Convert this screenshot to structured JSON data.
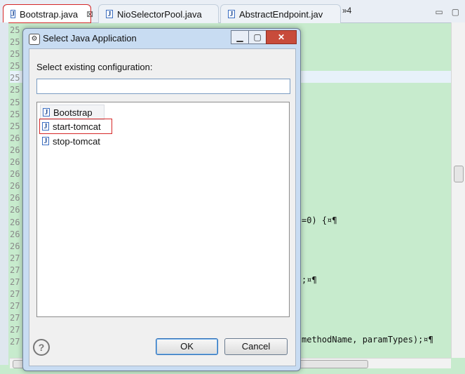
{
  "editor": {
    "tabs": [
      {
        "label": "Bootstrap.java",
        "icon": "java-file-icon"
      },
      {
        "label": "NioSelectorPool.java",
        "icon": "java-file-icon"
      },
      {
        "label": "AbstractEndpoint.jav",
        "icon": "java-file-icon"
      }
    ],
    "tab_overflow": "»4",
    "line_numbers": [
      "25",
      "25",
      "25",
      "25",
      "25",
      "25",
      "25",
      "25",
      "25",
      "26",
      "26",
      "26",
      "26",
      "26",
      "26",
      "26",
      "26",
      "26",
      "26",
      "27",
      "27",
      "27",
      "27",
      "27",
      "27",
      "27",
      "27"
    ],
    "code_fragments": [
      {
        "text": "=0) {¤¶"
      },
      {
        "text": ";¤¶"
      },
      {
        "text": "methodName, paramTypes);¤¶"
      }
    ]
  },
  "dialog": {
    "title": "Select Java Application",
    "label": "Select existing configuration:",
    "search_value": "",
    "items": [
      {
        "label": "Bootstrap"
      },
      {
        "label": "start-tomcat"
      },
      {
        "label": "stop-tomcat"
      }
    ],
    "ok_label": "OK",
    "cancel_label": "Cancel",
    "help_glyph": "?"
  },
  "colors": {
    "editor_background": "#c7ebcd",
    "dialog_frame": "#c8dcf2",
    "highlight_outline": "#d62828"
  }
}
